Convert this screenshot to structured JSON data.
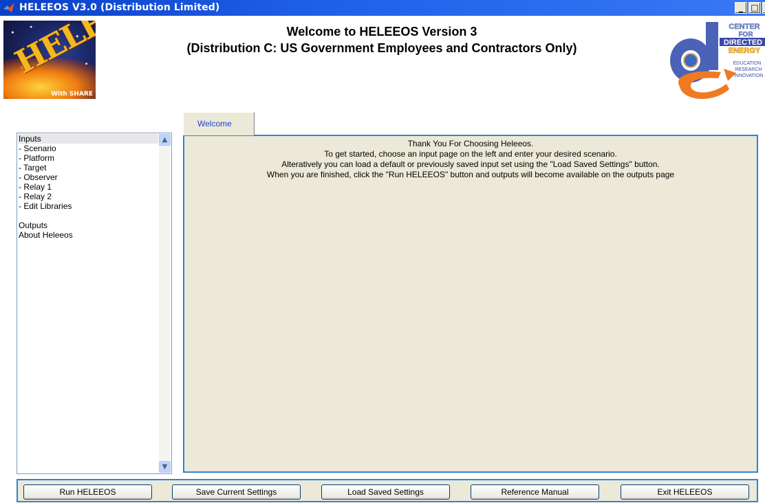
{
  "window": {
    "title": "HELEEOS V3.0 (Distribution Limited)",
    "controls": {
      "minimize": "_",
      "maximize": "□",
      "close": "×"
    }
  },
  "header": {
    "line1": "Welcome to HELEEOS Version 3",
    "line2": "(Distribution C: US Government Employees and Contractors Only)",
    "logo_left_text": "HELEEOS",
    "logo_left_subtext": "With SHARE",
    "logo_right_lines": [
      "CENTER",
      "FOR",
      "DIRECTED",
      "ENERGY",
      "EDUCATION",
      "RESEARCH",
      "INNOVATION"
    ]
  },
  "sidebar": {
    "items": [
      "Inputs",
      " - Scenario",
      " - Platform",
      " - Target",
      " - Observer",
      " - Relay 1",
      " - Relay 2",
      " - Edit Libraries",
      "",
      "Outputs",
      "About Heleeos"
    ],
    "selected_index": 0
  },
  "tabs": [
    {
      "label": "Welcome",
      "active": true
    }
  ],
  "welcome": {
    "lines": [
      "Thank You For Choosing Heleeos.",
      "To get started, choose an input page on the left and enter your desired scenario.",
      "Alteratively you can load a default or previously saved input set using the \"Load Saved Settings\" button.",
      "When you are finished, click the \"Run HELEEOS\" button and outputs will become available on the outputs page"
    ]
  },
  "buttons": {
    "run": "Run HELEEOS",
    "save": "Save Current Settings",
    "load": "Load Saved Settings",
    "manual": "Reference Manual",
    "exit": "Exit HELEEOS"
  },
  "colors": {
    "titlebar": "#1f5fe6",
    "panel_bg": "#ece9d8",
    "panel_border": "#2b84d8",
    "tab_label": "#1a3fd8"
  }
}
